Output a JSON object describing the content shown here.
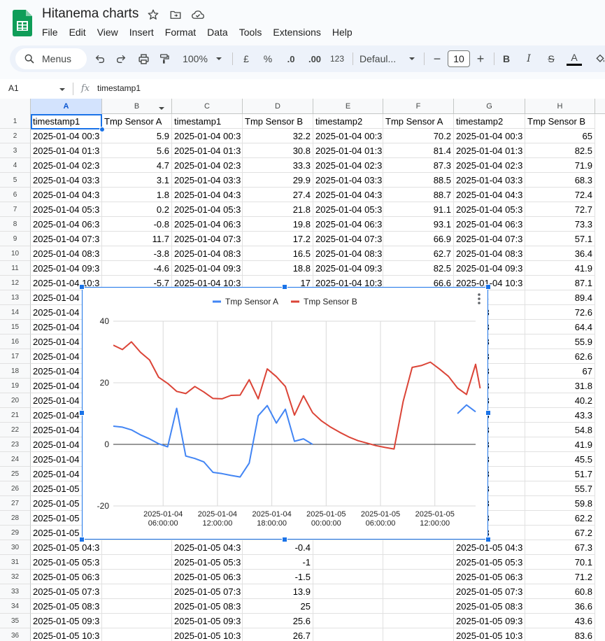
{
  "app": {
    "doc_title": "Hitanema charts",
    "menus": [
      "File",
      "Edit",
      "View",
      "Insert",
      "Format",
      "Data",
      "Tools",
      "Extensions",
      "Help"
    ]
  },
  "toolbar": {
    "search_label": "Menus",
    "zoom": "100%",
    "currency": "£",
    "percent": "%",
    "dec_decrease": ".0",
    "dec_increase": ".00",
    "number_format": "123",
    "font": "Defaul...",
    "font_size": "10",
    "minus": "−",
    "plus": "+",
    "bold": "B",
    "italic": "I",
    "strike": "S",
    "text_color": "A"
  },
  "formula_bar": {
    "cell_ref": "A1",
    "fx": "fx",
    "content": "timestamp1"
  },
  "columns": [
    "A",
    "B",
    "C",
    "D",
    "E",
    "F",
    "G",
    "H"
  ],
  "rows": [
    {
      "n": "1",
      "c": [
        "timestamp1",
        "Tmp Sensor A",
        "timestamp1",
        "Tmp Sensor B",
        "timestamp2",
        "Tmp Sensor A",
        "timestamp2",
        "Tmp Sensor B"
      ]
    },
    {
      "n": "2",
      "c": [
        "2025-01-04 00:3",
        "5.9",
        "2025-01-04 00:3",
        "32.2",
        "2025-01-04 00:3",
        "70.2",
        "2025-01-04 00:3",
        "65"
      ]
    },
    {
      "n": "3",
      "c": [
        "2025-01-04 01:3",
        "5.6",
        "2025-01-04 01:3",
        "30.8",
        "2025-01-04 01:3",
        "81.4",
        "2025-01-04 01:3",
        "82.5"
      ]
    },
    {
      "n": "4",
      "c": [
        "2025-01-04 02:3",
        "4.7",
        "2025-01-04 02:3",
        "33.3",
        "2025-01-04 02:3",
        "87.3",
        "2025-01-04 02:3",
        "71.9"
      ]
    },
    {
      "n": "5",
      "c": [
        "2025-01-04 03:3",
        "3.1",
        "2025-01-04 03:3",
        "29.9",
        "2025-01-04 03:3",
        "88.5",
        "2025-01-04 03:3",
        "68.3"
      ]
    },
    {
      "n": "6",
      "c": [
        "2025-01-04 04:3",
        "1.8",
        "2025-01-04 04:3",
        "27.4",
        "2025-01-04 04:3",
        "88.7",
        "2025-01-04 04:3",
        "72.4"
      ]
    },
    {
      "n": "7",
      "c": [
        "2025-01-04 05:3",
        "0.2",
        "2025-01-04 05:3",
        "21.8",
        "2025-01-04 05:3",
        "91.1",
        "2025-01-04 05:3",
        "72.7"
      ]
    },
    {
      "n": "8",
      "c": [
        "2025-01-04 06:3",
        "-0.8",
        "2025-01-04 06:3",
        "19.8",
        "2025-01-04 06:3",
        "93.1",
        "2025-01-04 06:3",
        "73.3"
      ]
    },
    {
      "n": "9",
      "c": [
        "2025-01-04 07:3",
        "11.7",
        "2025-01-04 07:3",
        "17.2",
        "2025-01-04 07:3",
        "66.9",
        "2025-01-04 07:3",
        "57.1"
      ]
    },
    {
      "n": "10",
      "c": [
        "2025-01-04 08:3",
        "-3.8",
        "2025-01-04 08:3",
        "16.5",
        "2025-01-04 08:3",
        "62.7",
        "2025-01-04 08:3",
        "36.4"
      ]
    },
    {
      "n": "11",
      "c": [
        "2025-01-04 09:3",
        "-4.6",
        "2025-01-04 09:3",
        "18.8",
        "2025-01-04 09:3",
        "82.5",
        "2025-01-04 09:3",
        "41.9"
      ]
    },
    {
      "n": "12",
      "c": [
        "2025-01-04 10:3",
        "-5.7",
        "2025-01-04 10:3",
        "17",
        "2025-01-04 10:3",
        "66.6",
        "2025-01-04 10:3",
        "87.1"
      ]
    },
    {
      "n": "13",
      "c": [
        "2025-01-04",
        "",
        "",
        "",
        "",
        "",
        "-04 11:3",
        "89.4"
      ]
    },
    {
      "n": "14",
      "c": [
        "2025-01-04",
        "",
        "",
        "",
        "",
        "",
        "-04 12:3",
        "72.6"
      ]
    },
    {
      "n": "15",
      "c": [
        "2025-01-04",
        "",
        "",
        "",
        "",
        "",
        "-04 13:3",
        "64.4"
      ]
    },
    {
      "n": "16",
      "c": [
        "2025-01-04",
        "",
        "",
        "",
        "",
        "",
        "-04 14:3",
        "55.9"
      ]
    },
    {
      "n": "17",
      "c": [
        "2025-01-04",
        "",
        "",
        "",
        "",
        "",
        "-04 15:3",
        "62.6"
      ]
    },
    {
      "n": "18",
      "c": [
        "2025-01-04",
        "",
        "",
        "",
        "",
        "",
        "-04 16:3",
        "67"
      ]
    },
    {
      "n": "19",
      "c": [
        "2025-01-04",
        "",
        "",
        "",
        "",
        "",
        "-04 17:3",
        "31.8"
      ]
    },
    {
      "n": "20",
      "c": [
        "2025-01-04",
        "",
        "",
        "",
        "",
        "",
        "-04 18:3",
        "40.2"
      ]
    },
    {
      "n": "21",
      "c": [
        "2025-01-04",
        "",
        "",
        "",
        "",
        "",
        "-04 19:3",
        "43.3"
      ]
    },
    {
      "n": "22",
      "c": [
        "2025-01-04",
        "",
        "",
        "",
        "",
        "",
        "-04 20:3",
        "54.8"
      ]
    },
    {
      "n": "23",
      "c": [
        "2025-01-04",
        "",
        "",
        "",
        "",
        "",
        "-04 21:3",
        "41.9"
      ]
    },
    {
      "n": "24",
      "c": [
        "2025-01-04",
        "",
        "",
        "",
        "",
        "",
        "-04 22:3",
        "45.5"
      ]
    },
    {
      "n": "25",
      "c": [
        "2025-01-04",
        "",
        "",
        "",
        "",
        "",
        "-04 23:3",
        "51.7"
      ]
    },
    {
      "n": "26",
      "c": [
        "2025-01-05",
        "",
        "",
        "",
        "",
        "",
        "-05 00:3",
        "55.7"
      ]
    },
    {
      "n": "27",
      "c": [
        "2025-01-05",
        "",
        "",
        "",
        "",
        "",
        "-05 01:3",
        "59.8"
      ]
    },
    {
      "n": "28",
      "c": [
        "2025-01-05",
        "",
        "",
        "",
        "",
        "",
        "-05 02:3",
        "62.2"
      ]
    },
    {
      "n": "29",
      "c": [
        "2025-01-05",
        "",
        "",
        "",
        "",
        "",
        "-05 03:3",
        "67.2"
      ]
    },
    {
      "n": "30",
      "c": [
        "2025-01-05 04:3",
        "",
        "2025-01-05 04:3",
        "-0.4",
        "",
        "",
        "2025-01-05 04:3",
        "67.3"
      ]
    },
    {
      "n": "31",
      "c": [
        "2025-01-05 05:3",
        "",
        "2025-01-05 05:3",
        "-1",
        "",
        "",
        "2025-01-05 05:3",
        "70.1"
      ]
    },
    {
      "n": "32",
      "c": [
        "2025-01-05 06:3",
        "",
        "2025-01-05 06:3",
        "-1.5",
        "",
        "",
        "2025-01-05 06:3",
        "71.2"
      ]
    },
    {
      "n": "33",
      "c": [
        "2025-01-05 07:3",
        "",
        "2025-01-05 07:3",
        "13.9",
        "",
        "",
        "2025-01-05 07:3",
        "60.8"
      ]
    },
    {
      "n": "34",
      "c": [
        "2025-01-05 08:3",
        "",
        "2025-01-05 08:3",
        "25",
        "",
        "",
        "2025-01-05 08:3",
        "36.6"
      ]
    },
    {
      "n": "35",
      "c": [
        "2025-01-05 09:3",
        "",
        "2025-01-05 09:3",
        "25.6",
        "",
        "",
        "2025-01-05 09:3",
        "43.6"
      ]
    },
    {
      "n": "36",
      "c": [
        "2025-01-05 10:3",
        "",
        "2025-01-05 10:3",
        "26.7",
        "",
        "",
        "2025-01-05 10:3",
        "83.6"
      ]
    }
  ],
  "chart_data": {
    "type": "line",
    "title": "",
    "xlabel": "",
    "ylabel": "",
    "ylim": [
      -20,
      40
    ],
    "yticks": [
      "40",
      "20",
      "0",
      "-20"
    ],
    "xticks": [
      {
        "at": 6,
        "date": "2025-01-04",
        "time": "06:00:00"
      },
      {
        "at": 12,
        "date": "2025-01-04",
        "time": "12:00:00"
      },
      {
        "at": 18,
        "date": "2025-01-04",
        "time": "18:00:00"
      },
      {
        "at": 24,
        "date": "2025-01-05",
        "time": "00:00:00"
      },
      {
        "at": 30,
        "date": "2025-01-05",
        "time": "06:00:00"
      },
      {
        "at": 36,
        "date": "2025-01-05",
        "time": "12:00:00"
      }
    ],
    "xlim": [
      0.5,
      40.5
    ],
    "grid": true,
    "legend": "top",
    "series": [
      {
        "name": "Tmp Sensor A",
        "color": "#4285f4",
        "segments": [
          [
            [
              0.5,
              5.9
            ],
            [
              1.5,
              5.6
            ],
            [
              2.5,
              4.7
            ],
            [
              3.5,
              3.1
            ],
            [
              4.5,
              1.8
            ],
            [
              5.5,
              0.2
            ],
            [
              6.5,
              -0.8
            ],
            [
              7.5,
              11.7
            ],
            [
              8.5,
              -3.8
            ],
            [
              9.5,
              -4.6
            ],
            [
              10.5,
              -5.7
            ],
            [
              11.5,
              -9.1
            ],
            [
              12.5,
              -9.5
            ],
            [
              13.5,
              -10.1
            ],
            [
              14.5,
              -10.6
            ],
            [
              15.5,
              -6.1
            ],
            [
              16.5,
              9.3
            ],
            [
              17.5,
              12.6
            ],
            [
              18.5,
              6.9
            ],
            [
              19.5,
              11.4
            ],
            [
              20.5,
              1.0
            ],
            [
              21.5,
              1.8
            ],
            [
              22.5,
              0.0
            ]
          ],
          [
            [
              38.5,
              10.0
            ],
            [
              39.5,
              12.8
            ],
            [
              40.5,
              10.6
            ]
          ]
        ]
      },
      {
        "name": "Tmp Sensor B",
        "color": "#db4437",
        "segments": [
          [
            [
              0.5,
              32.2
            ],
            [
              1.5,
              30.8
            ],
            [
              2.5,
              33.3
            ],
            [
              3.5,
              29.9
            ],
            [
              4.5,
              27.4
            ],
            [
              5.5,
              21.8
            ],
            [
              6.5,
              19.8
            ],
            [
              7.5,
              17.2
            ],
            [
              8.5,
              16.5
            ],
            [
              9.5,
              18.8
            ],
            [
              10.5,
              17.0
            ],
            [
              11.5,
              14.9
            ],
            [
              12.5,
              14.8
            ],
            [
              13.5,
              15.9
            ],
            [
              14.5,
              16.0
            ],
            [
              15.5,
              21.0
            ],
            [
              16.5,
              14.8
            ],
            [
              17.5,
              24.5
            ],
            [
              18.5,
              22.0
            ],
            [
              19.5,
              18.8
            ],
            [
              20.5,
              9.5
            ],
            [
              21.5,
              15.8
            ],
            [
              22.5,
              10.3
            ],
            [
              23.5,
              7.6
            ],
            [
              24.5,
              5.6
            ],
            [
              25.5,
              3.9
            ],
            [
              26.5,
              2.4
            ],
            [
              27.5,
              1.2
            ],
            [
              28.5,
              0.4
            ],
            [
              29.5,
              -0.4
            ],
            [
              30.5,
              -1.0
            ],
            [
              31.5,
              -1.5
            ],
            [
              32.5,
              13.9
            ],
            [
              33.5,
              25.0
            ],
            [
              34.5,
              25.6
            ],
            [
              35.5,
              26.7
            ],
            [
              36.5,
              24.5
            ],
            [
              37.5,
              22.1
            ],
            [
              38.5,
              18.3
            ],
            [
              39.5,
              16.2
            ],
            [
              40.5,
              26.0
            ],
            [
              41.0,
              18.2
            ]
          ]
        ]
      }
    ]
  }
}
